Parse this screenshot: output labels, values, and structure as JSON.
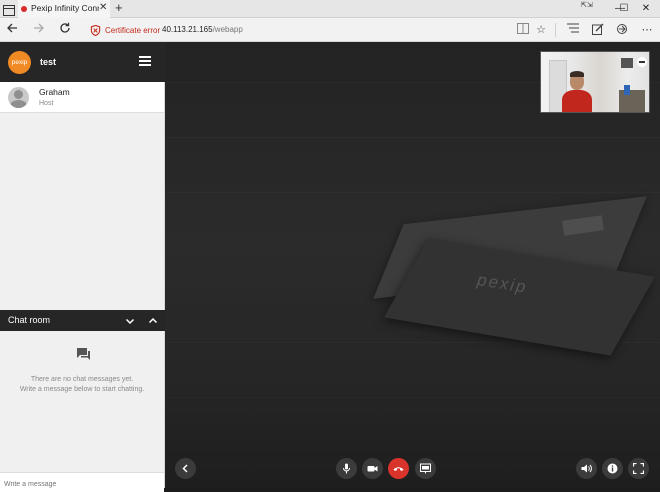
{
  "browser": {
    "tab_title": "Pexip Infinity Conne",
    "tab_close": "✕",
    "new_tab": "+",
    "cert_error": "Certificate error",
    "url_host": "40.113.21.165",
    "url_path": "/webapp",
    "window_controls": [
      "—",
      "☐",
      "✕"
    ]
  },
  "sidebar": {
    "logo_text": "pexip",
    "conference_name": "test",
    "participants": [
      {
        "name": "Graham",
        "role": "Host"
      }
    ]
  },
  "chat": {
    "title": "Chat room",
    "empty_line1": "There are no chat messages yet.",
    "empty_line2": "Write a message below to start chatting.",
    "input_placeholder": "Write a message"
  },
  "stage": {
    "card_brand": "pexip"
  },
  "colors": {
    "accent": "#f08a24",
    "hangup": "#d9342b",
    "cert_error": "#c42b1c"
  }
}
